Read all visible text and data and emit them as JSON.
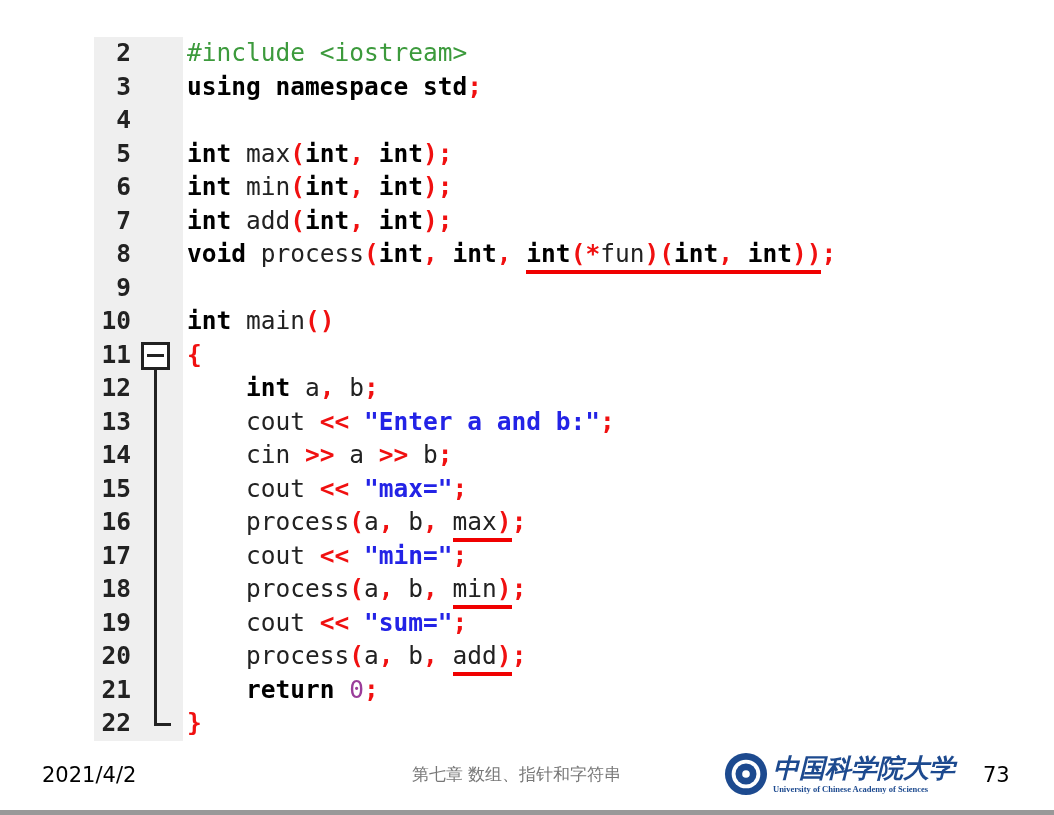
{
  "editor": {
    "lines": [
      {
        "number": "2",
        "kind": "plain",
        "tokens": [
          {
            "text": "#include <iostream>",
            "kind": "preprocessor"
          }
        ]
      },
      {
        "number": "3",
        "kind": "plain",
        "tokens": [
          {
            "text": "using namespace std",
            "kind": "keyword"
          },
          {
            "text": ";",
            "kind": "punct"
          }
        ]
      },
      {
        "number": "4",
        "kind": "plain"
      },
      {
        "number": "5",
        "kind": "plain",
        "tokens": [
          {
            "text": "int",
            "kind": "keyword"
          },
          {
            "text": " max",
            "kind": "ident"
          },
          {
            "text": "(",
            "kind": "punct"
          },
          {
            "text": "int",
            "kind": "keyword"
          },
          {
            "text": ", ",
            "kind": "punct"
          },
          {
            "text": "int",
            "kind": "keyword"
          },
          {
            "text": ");",
            "kind": "punct"
          }
        ]
      },
      {
        "number": "6",
        "kind": "plain",
        "tokens": [
          {
            "text": "int",
            "kind": "keyword"
          },
          {
            "text": " min",
            "kind": "ident"
          },
          {
            "text": "(",
            "kind": "punct"
          },
          {
            "text": "int",
            "kind": "keyword"
          },
          {
            "text": ", ",
            "kind": "punct"
          },
          {
            "text": "int",
            "kind": "keyword"
          },
          {
            "text": ");",
            "kind": "punct"
          }
        ]
      },
      {
        "number": "7",
        "kind": "plain",
        "tokens": [
          {
            "text": "int",
            "kind": "keyword"
          },
          {
            "text": " add",
            "kind": "ident"
          },
          {
            "text": "(",
            "kind": "punct"
          },
          {
            "text": "int",
            "kind": "keyword"
          },
          {
            "text": ", ",
            "kind": "punct"
          },
          {
            "text": "int",
            "kind": "keyword"
          },
          {
            "text": ");",
            "kind": "punct"
          }
        ]
      },
      {
        "number": "8",
        "kind": "plain",
        "tokens": [
          {
            "text": "void",
            "kind": "keyword"
          },
          {
            "text": " process",
            "kind": "ident"
          },
          {
            "text": "(",
            "kind": "punct"
          },
          {
            "text": "int",
            "kind": "keyword"
          },
          {
            "text": ", ",
            "kind": "punct"
          },
          {
            "text": "int",
            "kind": "keyword"
          },
          {
            "text": ", ",
            "kind": "punct"
          },
          {
            "kind": "underlined",
            "tokens": [
              {
                "text": "int",
                "kind": "keyword"
              },
              {
                "text": "(*",
                "kind": "punct"
              },
              {
                "text": "fun",
                "kind": "ident"
              },
              {
                "text": ")(",
                "kind": "punct"
              },
              {
                "text": "int",
                "kind": "keyword"
              },
              {
                "text": ", ",
                "kind": "punct"
              },
              {
                "text": "int",
                "kind": "keyword"
              },
              {
                "text": "))",
                "kind": "punct"
              }
            ]
          },
          {
            "text": ";",
            "kind": "punct"
          }
        ]
      },
      {
        "number": "9",
        "kind": "plain"
      },
      {
        "number": "10",
        "kind": "plain",
        "tokens": [
          {
            "text": "int",
            "kind": "keyword"
          },
          {
            "text": " main",
            "kind": "ident"
          },
          {
            "text": "()",
            "kind": "punct"
          }
        ]
      },
      {
        "number": "11",
        "kind": "fold_start",
        "tokens": [
          {
            "text": "{",
            "kind": "punct"
          }
        ]
      },
      {
        "number": "12",
        "kind": "fold_body",
        "tokens": [
          {
            "text": "    int",
            "kind": "keyword"
          },
          {
            "text": " a",
            "kind": "ident"
          },
          {
            "text": ", ",
            "kind": "punct"
          },
          {
            "text": "b",
            "kind": "ident"
          },
          {
            "text": ";",
            "kind": "punct"
          }
        ]
      },
      {
        "number": "13",
        "kind": "fold_body",
        "tokens": [
          {
            "text": "    cout",
            "kind": "ident"
          },
          {
            "text": " << ",
            "kind": "punct"
          },
          {
            "text": "\"Enter a and b:\"",
            "kind": "string"
          },
          {
            "text": ";",
            "kind": "punct"
          }
        ]
      },
      {
        "number": "14",
        "kind": "fold_body",
        "tokens": [
          {
            "text": "    cin",
            "kind": "ident"
          },
          {
            "text": " >> ",
            "kind": "punct"
          },
          {
            "text": "a",
            "kind": "ident"
          },
          {
            "text": " >> ",
            "kind": "punct"
          },
          {
            "text": "b",
            "kind": "ident"
          },
          {
            "text": ";",
            "kind": "punct"
          }
        ]
      },
      {
        "number": "15",
        "kind": "fold_body",
        "tokens": [
          {
            "text": "    cout",
            "kind": "ident"
          },
          {
            "text": " << ",
            "kind": "punct"
          },
          {
            "text": "\"max=\"",
            "kind": "string"
          },
          {
            "text": ";",
            "kind": "punct"
          }
        ]
      },
      {
        "number": "16",
        "kind": "fold_body",
        "tokens": [
          {
            "text": "    process",
            "kind": "ident"
          },
          {
            "text": "(",
            "kind": "punct"
          },
          {
            "text": "a",
            "kind": "ident"
          },
          {
            "text": ", ",
            "kind": "punct"
          },
          {
            "text": "b",
            "kind": "ident"
          },
          {
            "text": ", ",
            "kind": "punct"
          },
          {
            "kind": "underlined",
            "tokens": [
              {
                "text": "max",
                "kind": "ident"
              },
              {
                "text": ")",
                "kind": "punct"
              }
            ]
          },
          {
            "text": ";",
            "kind": "punct"
          }
        ]
      },
      {
        "number": "17",
        "kind": "fold_body",
        "tokens": [
          {
            "text": "    cout",
            "kind": "ident"
          },
          {
            "text": " << ",
            "kind": "punct"
          },
          {
            "text": "\"min=\"",
            "kind": "string"
          },
          {
            "text": ";",
            "kind": "punct"
          }
        ]
      },
      {
        "number": "18",
        "kind": "fold_body",
        "tokens": [
          {
            "text": "    process",
            "kind": "ident"
          },
          {
            "text": "(",
            "kind": "punct"
          },
          {
            "text": "a",
            "kind": "ident"
          },
          {
            "text": ", ",
            "kind": "punct"
          },
          {
            "text": "b",
            "kind": "ident"
          },
          {
            "text": ", ",
            "kind": "punct"
          },
          {
            "kind": "underlined",
            "tokens": [
              {
                "text": "min",
                "kind": "ident"
              },
              {
                "text": ")",
                "kind": "punct"
              }
            ]
          },
          {
            "text": ";",
            "kind": "punct"
          }
        ]
      },
      {
        "number": "19",
        "kind": "fold_body",
        "tokens": [
          {
            "text": "    cout",
            "kind": "ident"
          },
          {
            "text": " << ",
            "kind": "punct"
          },
          {
            "text": "\"sum=\"",
            "kind": "string"
          },
          {
            "text": ";",
            "kind": "punct"
          }
        ]
      },
      {
        "number": "20",
        "kind": "fold_body",
        "tokens": [
          {
            "text": "    process",
            "kind": "ident"
          },
          {
            "text": "(",
            "kind": "punct"
          },
          {
            "text": "a",
            "kind": "ident"
          },
          {
            "text": ", ",
            "kind": "punct"
          },
          {
            "text": "b",
            "kind": "ident"
          },
          {
            "text": ", ",
            "kind": "punct"
          },
          {
            "kind": "underlined",
            "tokens": [
              {
                "text": "add",
                "kind": "ident"
              },
              {
                "text": ")",
                "kind": "punct"
              }
            ]
          },
          {
            "text": ";",
            "kind": "punct"
          }
        ]
      },
      {
        "number": "21",
        "kind": "fold_body",
        "tokens": [
          {
            "text": "    return ",
            "kind": "keyword"
          },
          {
            "text": "0",
            "kind": "number"
          },
          {
            "text": ";",
            "kind": "punct"
          }
        ]
      },
      {
        "number": "22",
        "kind": "fold_end",
        "tokens": [
          {
            "text": "}",
            "kind": "punct"
          }
        ]
      }
    ]
  },
  "footer": {
    "date": "2021/4/2",
    "chapter": "第七章 数组、指针和字符串",
    "logo": {
      "name_zh": "中国科学院大学",
      "name_en": "University of Chinese Academy of Sciences"
    },
    "page_number": "73"
  }
}
